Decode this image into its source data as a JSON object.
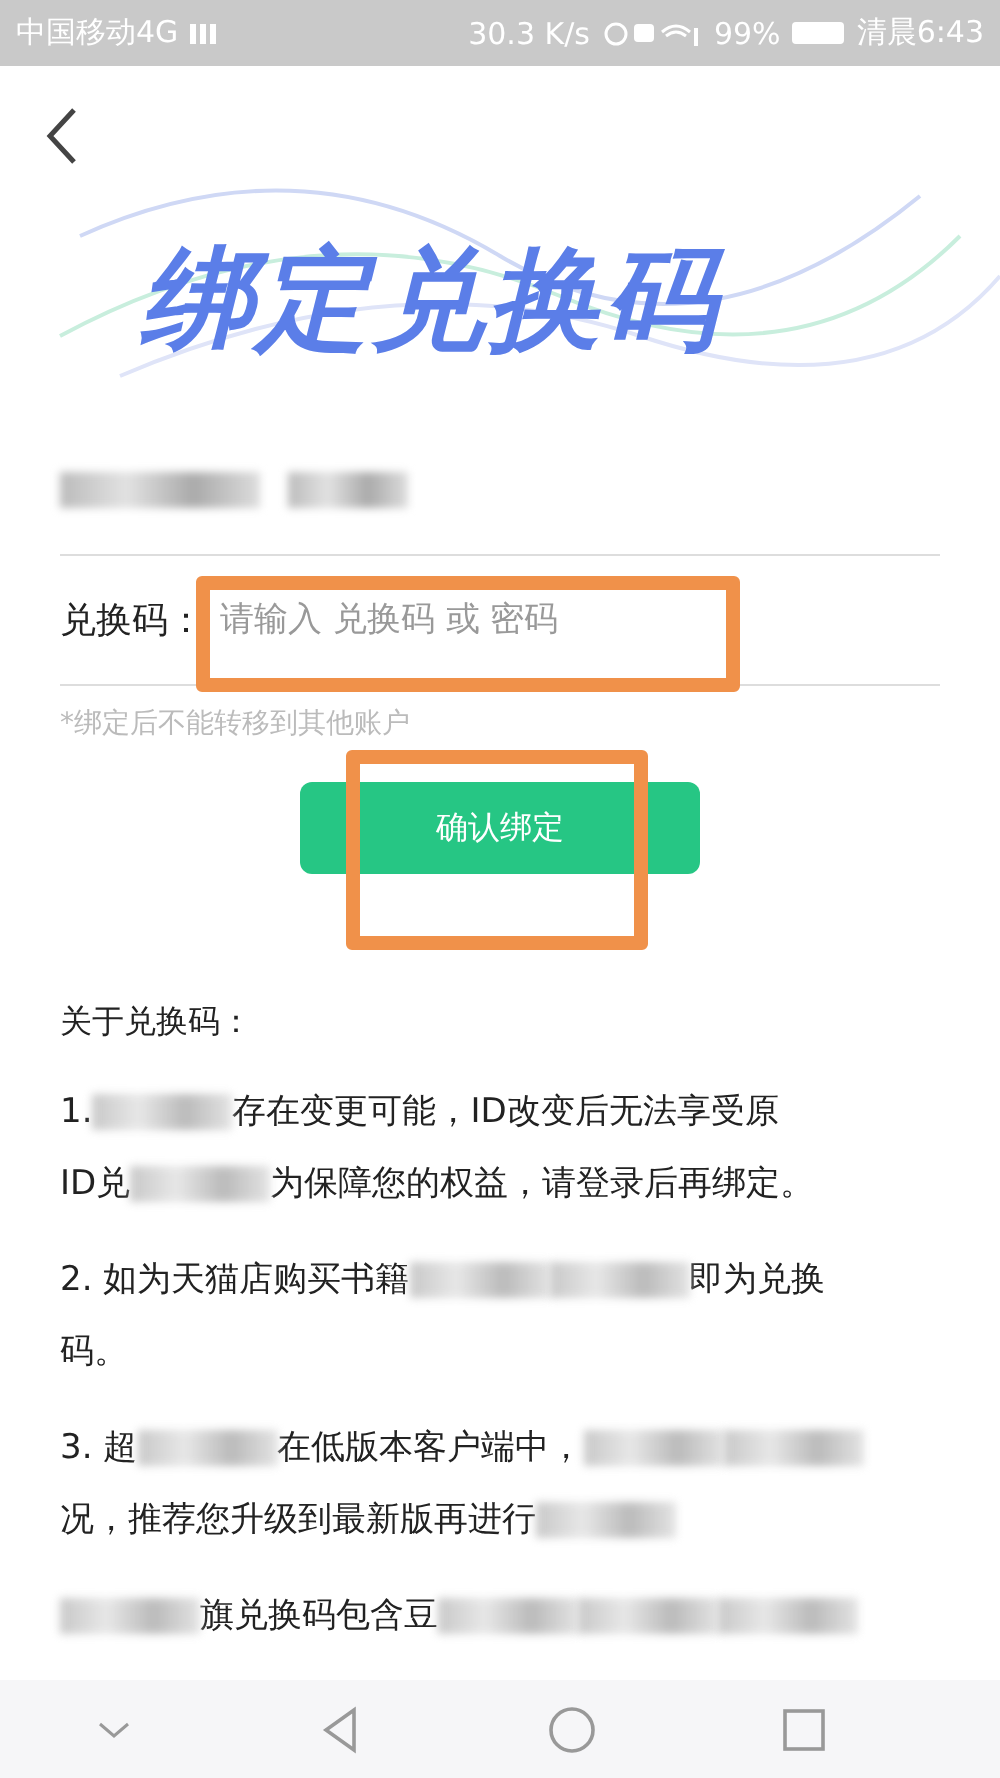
{
  "status_bar": {
    "carrier": "中国移动4G",
    "speed": "30.3 K/s",
    "battery": "99%",
    "time": "清晨6:43"
  },
  "title": "绑定兑换码",
  "account_row": {
    "blurred": true
  },
  "code_field": {
    "label": "兑换码：",
    "placeholder": "请输入 兑换码 或 密码",
    "highlighted": true
  },
  "hint": "*绑定后不能转移到其他账户",
  "confirm_button": {
    "label": "确认绑定",
    "highlighted": true
  },
  "about_title": "关于兑换码：",
  "paragraphs": [
    {
      "lines": [
        [
          {
            "kind": "text",
            "text": "1."
          },
          {
            "kind": "blur"
          },
          {
            "kind": "text",
            "text": "存在变更可能，ID改变后无法享受原"
          }
        ],
        [
          {
            "kind": "text",
            "text": "ID兑"
          },
          {
            "kind": "blur"
          },
          {
            "kind": "text",
            "text": "为保障您的权益，请登录后再绑定。"
          }
        ]
      ]
    },
    {
      "lines": [
        [
          {
            "kind": "text",
            "text": "2. 如为天猫店购买书籍"
          },
          {
            "kind": "blur"
          },
          {
            "kind": "blur"
          },
          {
            "kind": "text",
            "text": "即为兑换"
          }
        ],
        [
          {
            "kind": "text",
            "text": "码。"
          }
        ]
      ]
    },
    {
      "lines": [
        [
          {
            "kind": "text",
            "text": "3. 超"
          },
          {
            "kind": "blur"
          },
          {
            "kind": "text",
            "text": "在低版本客户端中，"
          },
          {
            "kind": "blur"
          },
          {
            "kind": "blur"
          }
        ],
        [
          {
            "kind": "text",
            "text": "况，推荐您升级到最新版再进行"
          },
          {
            "kind": "blur"
          }
        ]
      ]
    },
    {
      "lines": [
        [
          {
            "kind": "blur"
          },
          {
            "kind": "text",
            "text": "旗兑换码包含豆"
          },
          {
            "kind": "blur"
          },
          {
            "kind": "blur"
          },
          {
            "kind": "blur"
          }
        ]
      ]
    }
  ]
}
